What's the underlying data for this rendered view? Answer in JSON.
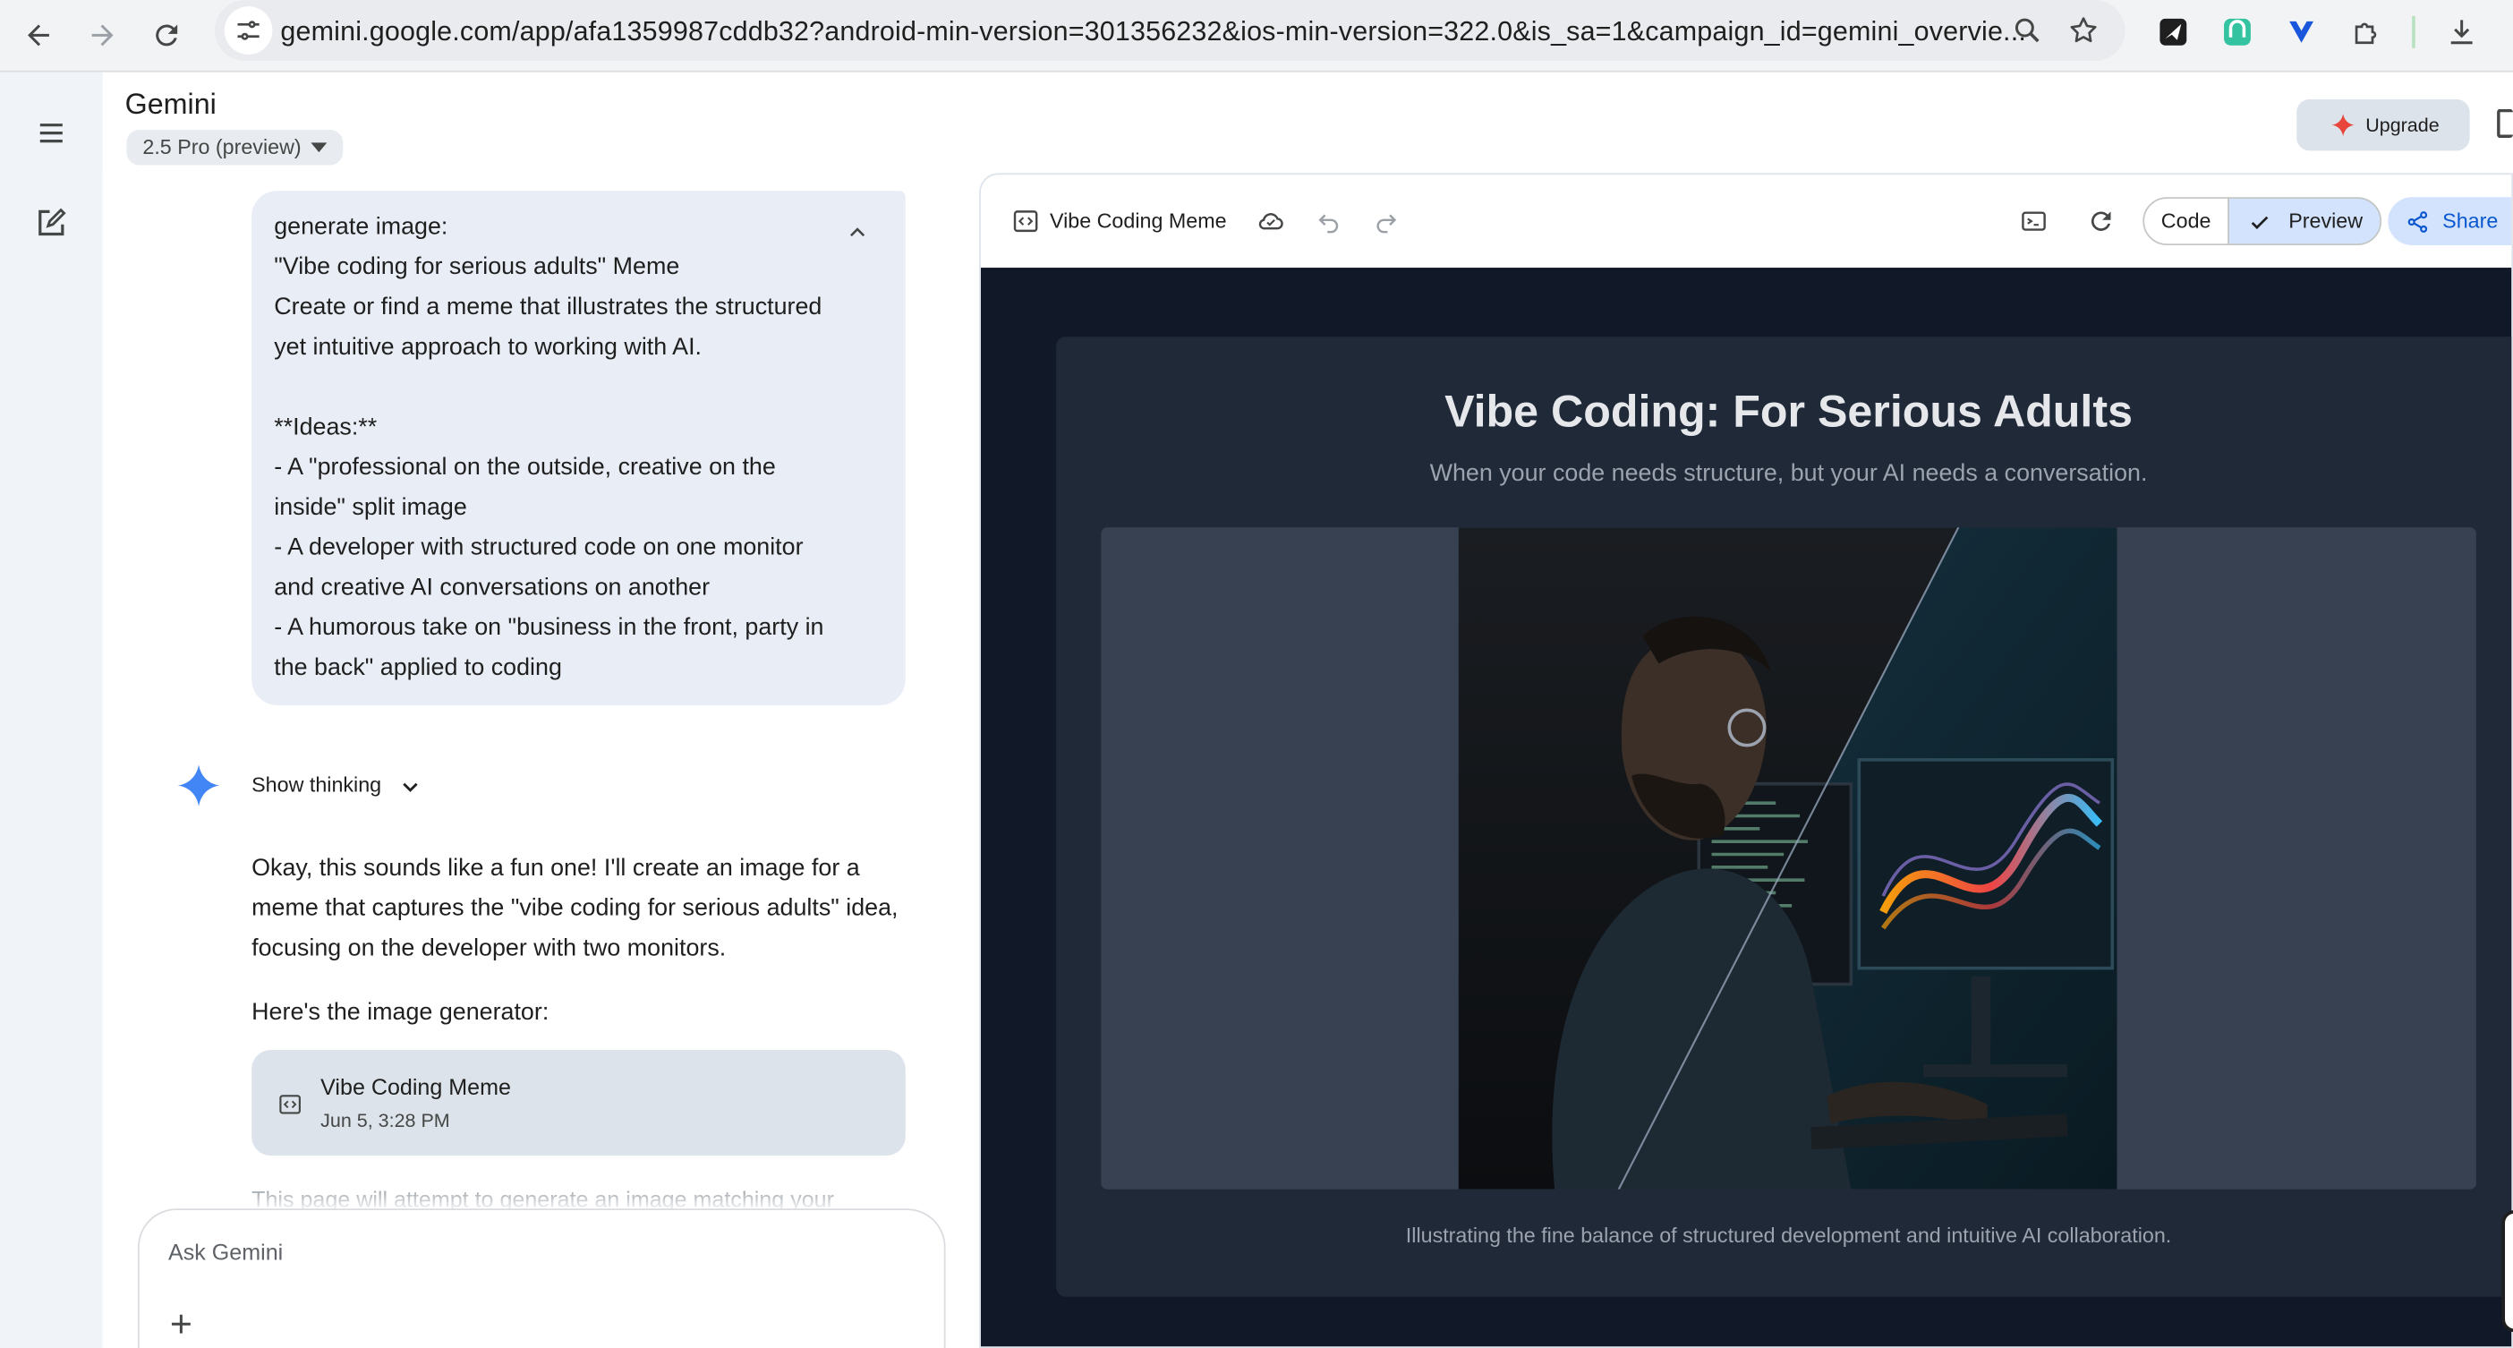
{
  "browser": {
    "url": "gemini.google.com/app/afa1359987cddb32?android-min-version=301356232&ios-min-version=322.0&is_sa=1&campaign_id=gemini_overvie..."
  },
  "header": {
    "app_title": "Gemini",
    "model": "2.5 Pro (preview)",
    "upgrade_label": "Upgrade"
  },
  "chat": {
    "user_prompt_lines": [
      "generate image:",
      "\"Vibe coding for serious adults\" Meme",
      "Create or find a meme that illustrates the structured",
      "yet intuitive approach to working with AI.",
      "",
      "**Ideas:**",
      "- A \"professional on the outside, creative on the",
      "inside\" split image",
      "- A developer with structured code on one monitor",
      "and creative AI conversations on another",
      "- A humorous take on \"business in the front, party in",
      "the back\" applied to coding"
    ],
    "show_thinking_label": "Show thinking",
    "response_lines": [
      "Okay, this sounds like a fun one! I'll create an image for a",
      "meme that captures the \"vibe coding for serious adults\" idea,",
      "focusing on the developer with two monitors."
    ],
    "response_line_2": "Here's the image generator:",
    "artifact": {
      "title": "Vibe Coding Meme",
      "date": "Jun 5, 3:28 PM"
    },
    "faded_text": "This page will attempt to generate an image matching your",
    "input_placeholder": "Ask Gemini"
  },
  "canvas": {
    "title": "Vibe Coding Meme",
    "code_label": "Code",
    "preview_label": "Preview",
    "share_label": "Share",
    "meme": {
      "title": "Vibe Coding: For Serious Adults",
      "subtitle": "When your code needs structure, but your AI needs a conversation.",
      "caption": "Illustrating the fine balance of structured development and intuitive AI collaboration."
    }
  },
  "colors": {
    "accent_blue": "#0b57d0",
    "preview_bg": "#111827",
    "card_bg": "#1f2937",
    "user_bubble": "#e9eef6"
  }
}
